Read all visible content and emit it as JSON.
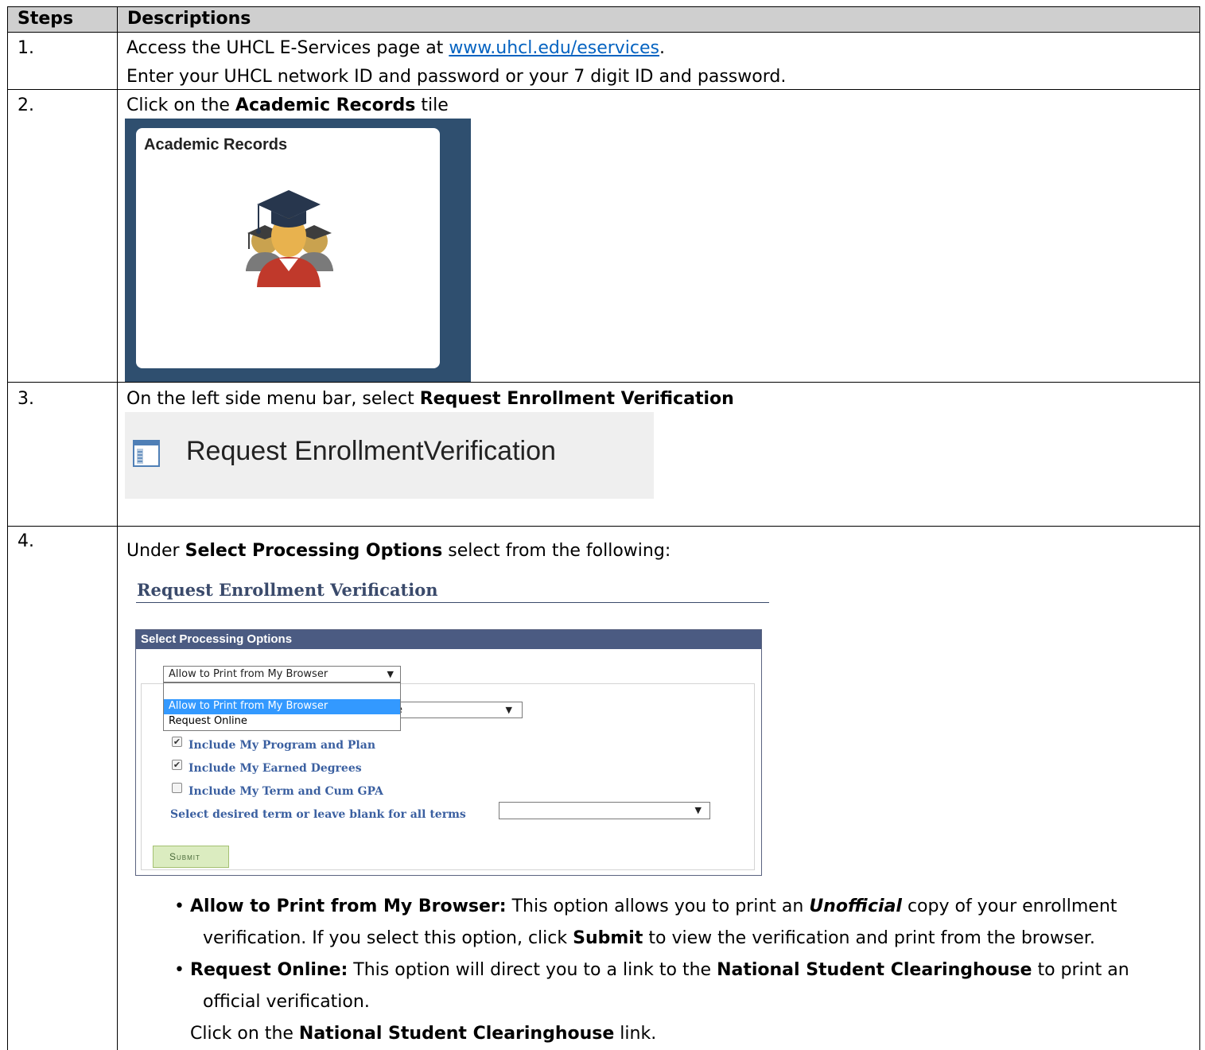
{
  "table": {
    "headers": {
      "steps": "Steps",
      "descriptions": "Descriptions"
    },
    "step1": {
      "num": "1.",
      "line1_pre": "Access the UHCL E-Services page at ",
      "line1_link": "www.uhcl.edu/eservices",
      "line1_post": ".",
      "line2": "Enter your UHCL network ID and password or your 7 digit ID and password."
    },
    "step2": {
      "num": "2.",
      "pre": "Click on the ",
      "bold": "Academic Records",
      "post": " tile",
      "tile_title": "Academic Records",
      "tile_icon": "graduates-icon"
    },
    "step3": {
      "num": "3.",
      "pre": "On the left side menu bar, select ",
      "bold": "Request Enrollment Verification",
      "menu_icon": "page-icon",
      "menu_label": "Request EnrollmentVerification"
    },
    "step4": {
      "num": "4.",
      "pre": "Under ",
      "bold": "Select Processing Options",
      "post": " select from the following:",
      "form": {
        "page_title": "Request Enrollment Verification",
        "panel_title": "Select Processing Options",
        "select_value": "Allow to Print from My Browser",
        "options": [
          "Allow to Print from My Browser",
          "Request Online"
        ],
        "hidden_select_fragment": "e",
        "checkbox1": {
          "label": "Include My Program and Plan",
          "checked": true
        },
        "checkbox2": {
          "label": "Include My Earned Degrees",
          "checked": true
        },
        "checkbox3": {
          "label": "Include My Term and Cum GPA",
          "checked": false
        },
        "term_label": "Select desired term or leave blank for all terms",
        "term_value": "",
        "submit_label": "Submit"
      },
      "bullet1": {
        "bold": "Allow to Print from My Browser:",
        "t1": " This option allows you to print an ",
        "em": "Unofficial",
        "t2": " copy of your enrollment",
        "line2_a": "verification. If you select this option, click ",
        "line2_bold": "Submit",
        "line2_b": " to view the verification and print from the browser."
      },
      "bullet2": {
        "bold": "Request Online:",
        "t1": " This option will direct you to a link to the ",
        "bold2": "National Student Clearinghouse",
        "t2": " to print an",
        "line2": "official verification."
      },
      "closing": {
        "pre": "Click on the ",
        "bold": "National Student Clearinghouse",
        "post": " link."
      }
    }
  }
}
